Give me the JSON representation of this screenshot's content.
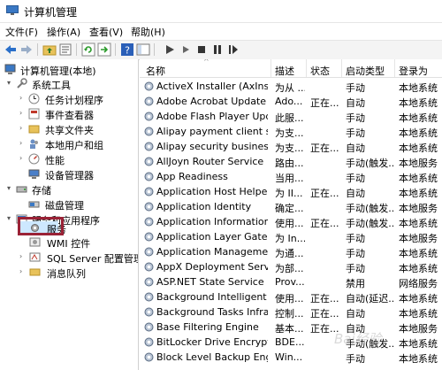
{
  "window": {
    "title": "计算机管理"
  },
  "menu": [
    {
      "label": "文件(F)"
    },
    {
      "label": "操作(A)"
    },
    {
      "label": "查看(V)"
    },
    {
      "label": "帮助(H)"
    }
  ],
  "toolbar": {
    "icons": [
      "back-icon",
      "forward-icon",
      "folder-up-icon",
      "properties-icon",
      "refresh-icon",
      "export-icon",
      "help-icon",
      "console-icon",
      "play-icon",
      "play-alt-icon",
      "stop-icon",
      "pause-icon",
      "restart-icon"
    ]
  },
  "tree": {
    "items": [
      {
        "label": "计算机管理(本地)",
        "icon": "computer-icon"
      },
      {
        "label": "系统工具",
        "icon": "tools-icon"
      },
      {
        "label": "任务计划程序",
        "icon": "clock-icon"
      },
      {
        "label": "事件查看器",
        "icon": "event-viewer-icon"
      },
      {
        "label": "共享文件夹",
        "icon": "shared-folder-icon"
      },
      {
        "label": "本地用户和组",
        "icon": "users-icon"
      },
      {
        "label": "性能",
        "icon": "performance-icon"
      },
      {
        "label": "设备管理器",
        "icon": "device-manager-icon"
      },
      {
        "label": "存储",
        "icon": "storage-icon"
      },
      {
        "label": "磁盘管理",
        "icon": "disk-icon"
      },
      {
        "label": "服务和应用程序",
        "icon": "services-apps-icon"
      },
      {
        "label": "服务",
        "icon": "services-icon"
      },
      {
        "label": "WMI 控件",
        "icon": "wmi-icon"
      },
      {
        "label": "SQL Server 配置管理器",
        "icon": "sql-server-icon"
      },
      {
        "label": "消息队列",
        "icon": "message-queue-icon"
      }
    ]
  },
  "services": {
    "columns": [
      "名称",
      "描述",
      "状态",
      "启动类型",
      "登录为"
    ],
    "rows": [
      {
        "name": "ActiveX Installer (AxInstSV)",
        "desc": "为从 ...",
        "status": "",
        "startup": "手动",
        "logon": "本地系统"
      },
      {
        "name": "Adobe Acrobat Update S...",
        "desc": "Ado...",
        "status": "正在...",
        "startup": "自动",
        "logon": "本地系统"
      },
      {
        "name": "Adobe Flash Player Upda...",
        "desc": "此服...",
        "status": "",
        "startup": "手动",
        "logon": "本地系统"
      },
      {
        "name": "Alipay payment client sec...",
        "desc": "为支...",
        "status": "",
        "startup": "手动",
        "logon": "本地系统"
      },
      {
        "name": "Alipay security business s...",
        "desc": "为支...",
        "status": "正在...",
        "startup": "自动",
        "logon": "本地系统"
      },
      {
        "name": "AllJoyn Router Service",
        "desc": "路由...",
        "status": "",
        "startup": "手动(触发...",
        "logon": "本地服务"
      },
      {
        "name": "App Readiness",
        "desc": "当用...",
        "status": "",
        "startup": "手动",
        "logon": "本地系统"
      },
      {
        "name": "Application Host Helper ...",
        "desc": "为 II...",
        "status": "正在...",
        "startup": "自动",
        "logon": "本地系统"
      },
      {
        "name": "Application Identity",
        "desc": "确定...",
        "status": "",
        "startup": "手动(触发...",
        "logon": "本地服务"
      },
      {
        "name": "Application Information",
        "desc": "使用...",
        "status": "正在...",
        "startup": "手动(触发...",
        "logon": "本地系统"
      },
      {
        "name": "Application Layer Gatewa...",
        "desc": "为 In...",
        "status": "",
        "startup": "手动",
        "logon": "本地服务"
      },
      {
        "name": "Application Management",
        "desc": "为通...",
        "status": "",
        "startup": "手动",
        "logon": "本地系统"
      },
      {
        "name": "AppX Deployment Servic...",
        "desc": "为部...",
        "status": "",
        "startup": "手动",
        "logon": "本地系统"
      },
      {
        "name": "ASP.NET State Service",
        "desc": "Prov...",
        "status": "",
        "startup": "禁用",
        "logon": "网络服务"
      },
      {
        "name": "Background Intelligent T...",
        "desc": "使用...",
        "status": "正在...",
        "startup": "自动(延迟...",
        "logon": "本地系统"
      },
      {
        "name": "Background Tasks Infras...",
        "desc": "控制...",
        "status": "正在...",
        "startup": "自动",
        "logon": "本地系统"
      },
      {
        "name": "Base Filtering Engine",
        "desc": "基本...",
        "status": "正在...",
        "startup": "自动",
        "logon": "本地服务"
      },
      {
        "name": "BitLocker Drive Encryptio...",
        "desc": "BDE...",
        "status": "",
        "startup": "手动(触发...",
        "logon": "本地系统"
      },
      {
        "name": "Block Level Backup Engi...",
        "desc": "Win...",
        "status": "",
        "startup": "手动",
        "logon": "本地系统"
      }
    ]
  },
  "watermark": "Bai经验"
}
